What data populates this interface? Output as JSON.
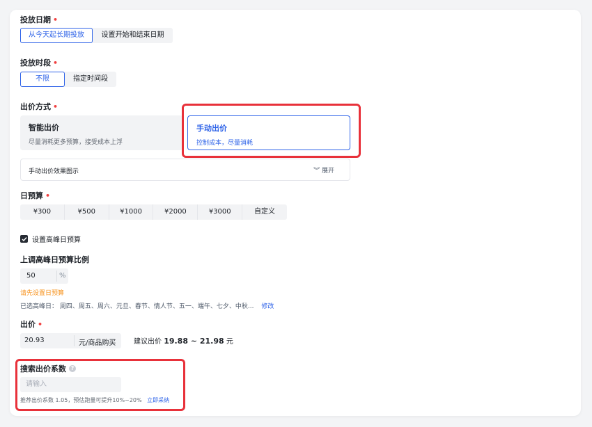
{
  "schedule": {
    "label": "投放日期",
    "options": [
      "从今天起长期投放",
      "设置开始和结束日期"
    ]
  },
  "time_slot": {
    "label": "投放时段",
    "options": [
      "不限",
      "指定时间段"
    ]
  },
  "bid_method": {
    "label": "出价方式",
    "smart": {
      "title": "智能出价",
      "desc": "尽量消耗更多预算，接受成本上浮"
    },
    "manual": {
      "title": "手动出价",
      "desc": "控制成本，尽量消耗"
    },
    "effect_title": "手动出价效果图示",
    "expand_label": "展开"
  },
  "daily_budget": {
    "label": "日预算",
    "options": [
      "¥300",
      "¥500",
      "¥1000",
      "¥2000",
      "¥3000",
      "自定义"
    ]
  },
  "peak": {
    "checkbox_label": "设置高峰日预算",
    "ratio_label": "上调高峰日预算比例",
    "ratio_value": "50",
    "ratio_unit": "%",
    "warning": "请先设置日预算",
    "selected_prefix": "已选高峰日：",
    "selected_days": "周四、周五、周六、元旦、春节、情人节、五一、端午、七夕、中秋...",
    "edit_label": "修改"
  },
  "bid": {
    "label": "出价",
    "value": "20.93",
    "unit": "元/商品购买",
    "suggest_prefix": "建议出价",
    "suggest_range": "19.88 ~ 21.98",
    "suggest_unit": "元"
  },
  "search_coef": {
    "label": "搜索出价系数",
    "placeholder": "请输入",
    "hint": "推荐出价系数 1.05，预估跑量可提升10%~20%",
    "adopt_label": "立即采纳"
  },
  "colors": {
    "accent": "#2e63e8",
    "required": "#f04040",
    "warning": "#f7931e",
    "highlight": "#e8313a"
  }
}
